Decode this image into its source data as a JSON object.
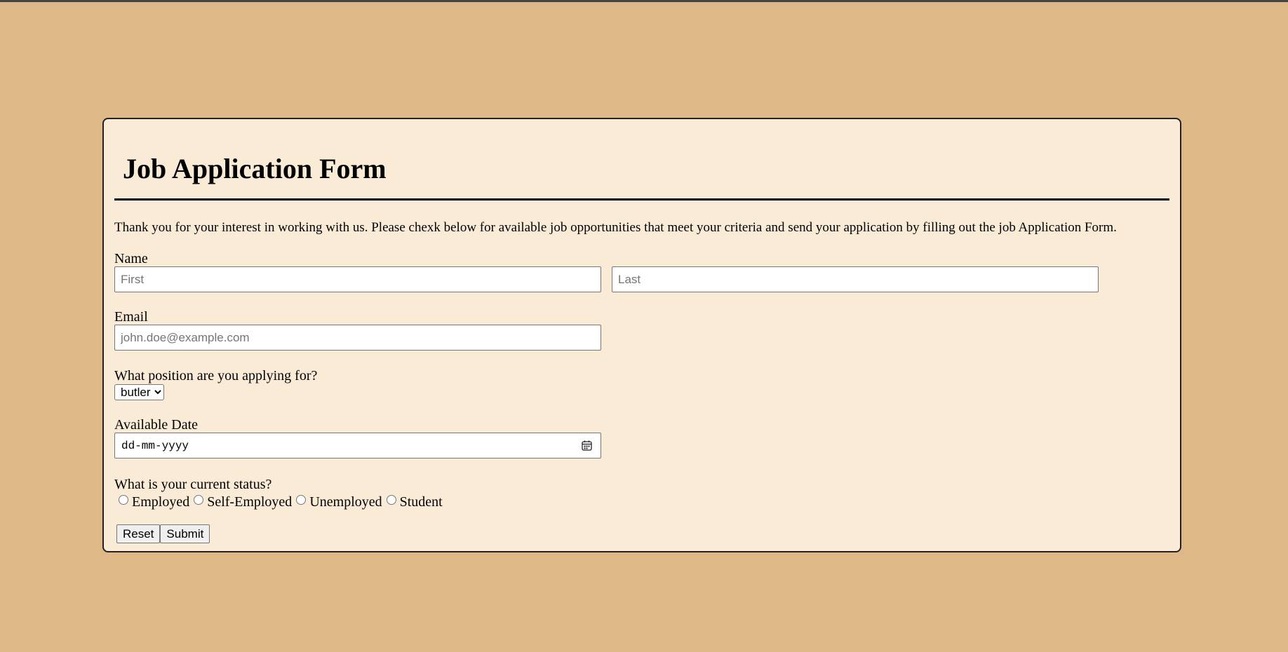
{
  "form": {
    "title": "Job Application Form",
    "intro": "Thank you for your interest in working with us. Please chexk below for available job opportunities that meet your criteria and send your application by filling out the job Application Form.",
    "name": {
      "label": "Name",
      "first_placeholder": "First",
      "last_placeholder": "Last",
      "first_value": "",
      "last_value": ""
    },
    "email": {
      "label": "Email",
      "placeholder": "john.doe@example.com",
      "value": ""
    },
    "position": {
      "label": "What position are you applying for?",
      "selected": "butler"
    },
    "date": {
      "label": "Available Date",
      "placeholder": "dd-mm-yyyy",
      "icon": "calendar-icon"
    },
    "status": {
      "label": "What is your current status?",
      "options": [
        "Employed",
        "Self-Employed",
        "Unemployed",
        "Student"
      ],
      "selected": null
    },
    "buttons": {
      "reset": "Reset",
      "submit": "Submit"
    }
  },
  "colors": {
    "page_background": "#deb887",
    "card_background": "#faebd7",
    "card_border": "#222222"
  }
}
